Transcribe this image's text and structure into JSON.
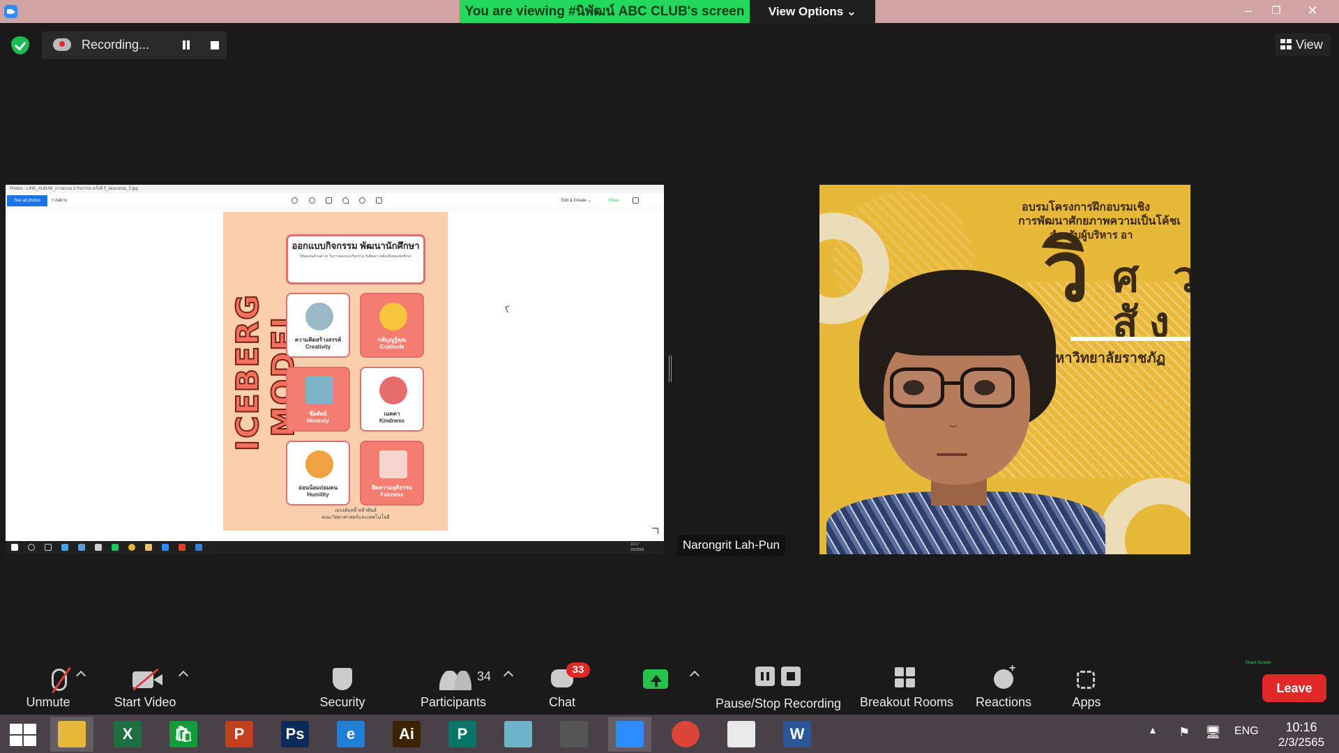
{
  "topbar": {
    "viewing_banner": "You are viewing #นิพัฒน์ ABC CLUB's screen",
    "view_options": "View Options ⌄",
    "minimize": "–",
    "restore": "❐",
    "close": "✕"
  },
  "recording": {
    "status": "Recording..."
  },
  "view_button": "View",
  "shared_screen": {
    "photos_title": "Photos - LINE_ALBUM_การอบรม 3 กิจกรรม ครั้งที่ 5_lelaconda_5.jpg",
    "see_all_photos": "See all photos",
    "add_to": "+ Add to",
    "edit_create": "Edit & Create ⌄",
    "share": "Share",
    "poster": {
      "vertical_title": "ICEBERG MODEL",
      "header_title": "ออกแบบกิจกรรม พัฒนานักศึกษา",
      "header_subtitle": "ใช้จุดเด่นด้านต่างๆ ในการออกแบบกิจกรรม รับผิดความคิดเห็นของนักศึกษา",
      "cards": [
        {
          "label_th": "ความคิดสร้างสรรค์",
          "label_en": "Creativity"
        },
        {
          "label_th": "กตัญญูรู้คุณ",
          "label_en": "Gratitude"
        },
        {
          "label_th": "ซื่อสัตย์",
          "label_en": "Honesty"
        },
        {
          "label_th": "เมตตา",
          "label_en": "Kindness"
        },
        {
          "label_th": "อ่อนน้อมถ่อมตน",
          "label_en": "Humility"
        },
        {
          "label_th": "ยึดความยุติธรรม",
          "label_en": "Fairness"
        }
      ],
      "credit_line1": "ณรงค์ฤทธิ์ หล้าพันธ์",
      "credit_line2": "คณะวิทยาศาสตร์และเทคโนโลยี"
    },
    "inner_clock_time": "10:17",
    "inner_clock_date": "2/3/2565"
  },
  "participant": {
    "name": "Narongrit Lah-Pun",
    "background_text": {
      "line1": "อบรมโครงการฝึกอบรมเชิง",
      "line2": "การพัฒนาศักยภาพความเป็นโค้ชเ",
      "line3": "สำหรับผู้บริหาร อา",
      "big1": "วิ",
      "big2": "ศ ว",
      "big3": "สัง",
      "line4": "มหาวิทยาลัยราชภัฏ"
    }
  },
  "toolbar": {
    "unmute": "Unmute",
    "start_video": "Start Video",
    "security": "Security",
    "participants": "Participants",
    "participants_count": "34",
    "chat": "Chat",
    "chat_badge": "33",
    "share_screen": "Share Screen",
    "pause_stop_recording": "Pause/Stop Recording",
    "breakout_rooms": "Breakout Rooms",
    "reactions": "Reactions",
    "apps": "Apps",
    "leave": "Leave"
  },
  "taskbar": {
    "apps": [
      {
        "name": "file-explorer",
        "glyph": "",
        "color": "#e8b83a"
      },
      {
        "name": "excel",
        "glyph": "X",
        "color": "#1d6f42"
      },
      {
        "name": "store",
        "glyph": "🛍",
        "color": "#0f9d3a"
      },
      {
        "name": "powerpoint",
        "glyph": "P",
        "color": "#c43e1c"
      },
      {
        "name": "photoshop",
        "glyph": "Ps",
        "color": "#0b2a5b"
      },
      {
        "name": "internet-explorer",
        "glyph": "e",
        "color": "#1e7fd6"
      },
      {
        "name": "illustrator",
        "glyph": "Ai",
        "color": "#3b2200"
      },
      {
        "name": "publisher",
        "glyph": "P",
        "color": "#077568"
      },
      {
        "name": "notepad",
        "glyph": "",
        "color": "#6fb3c8"
      },
      {
        "name": "photoscape",
        "glyph": "",
        "color": "#555555"
      },
      {
        "name": "zoom",
        "glyph": "",
        "color": "#2d8cff"
      },
      {
        "name": "chrome",
        "glyph": "",
        "color": "#db4437"
      },
      {
        "name": "powerpoint-viewer",
        "glyph": "",
        "color": "#e9e9e9"
      },
      {
        "name": "word",
        "glyph": "W",
        "color": "#2b579a"
      }
    ],
    "language": "ENG",
    "time": "10:16",
    "date": "2/3/2565"
  }
}
